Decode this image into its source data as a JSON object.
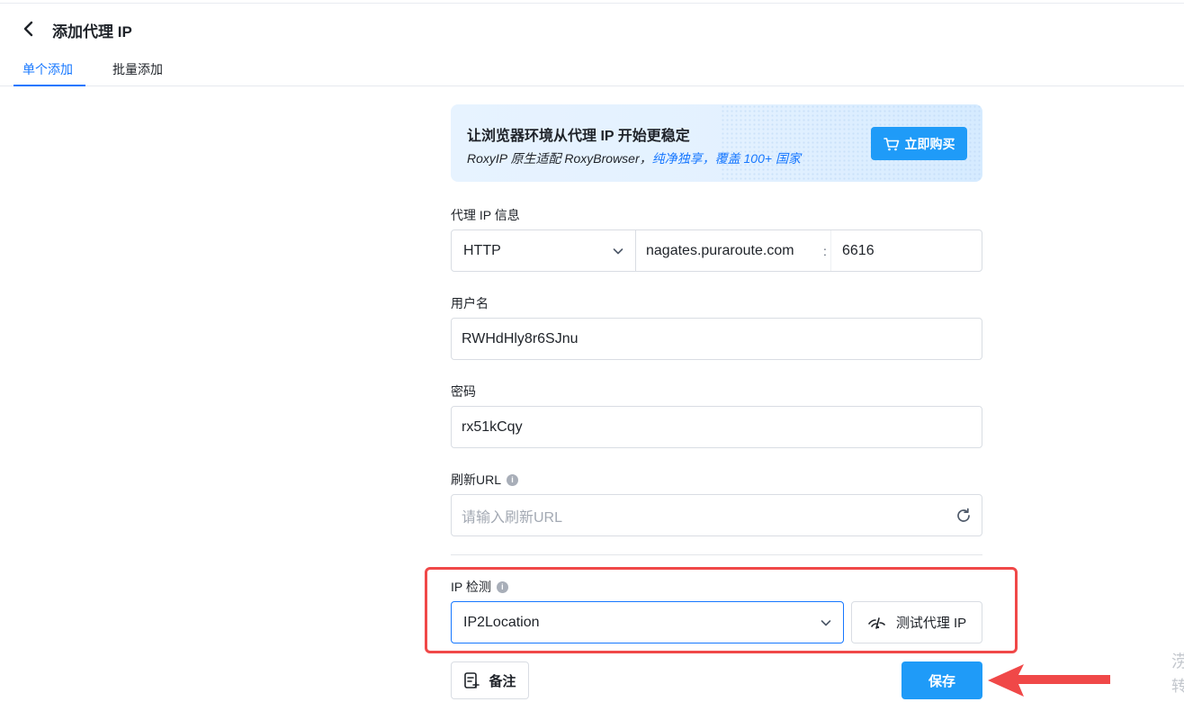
{
  "header": {
    "title": "添加代理 IP"
  },
  "tabs": [
    {
      "label": "单个添加",
      "active": true
    },
    {
      "label": "批量添加",
      "active": false
    }
  ],
  "banner": {
    "title": "让浏览器环境从代理 IP 开始更稳定",
    "sub_prefix": "RoxyIP 原生适配 RoxyBrowser，",
    "sub_highlight": "纯净独享，覆盖 100+ 国家",
    "buy_label": "立即购买"
  },
  "proxy": {
    "label": "代理 IP 信息",
    "protocol": "HTTP",
    "host": "nagates.puraroute.com",
    "separator": ":",
    "port": "6616"
  },
  "username": {
    "label": "用户名",
    "value": "RWHdHly8r6SJnu"
  },
  "password": {
    "label": "密码",
    "value": "rx51kCqy"
  },
  "refresh_url": {
    "label": "刷新URL",
    "placeholder": "请输入刷新URL"
  },
  "ip_check": {
    "label": "IP 检测",
    "value": "IP2Location",
    "test_label": "测试代理 IP"
  },
  "actions": {
    "note_label": "备注",
    "save_label": "保存"
  },
  "edge_text": {
    "top": "涝",
    "bottom": "转"
  },
  "colors": {
    "accent": "#1677ff",
    "primary_button": "#1f9bf8",
    "annotation_red": "#f04848"
  }
}
